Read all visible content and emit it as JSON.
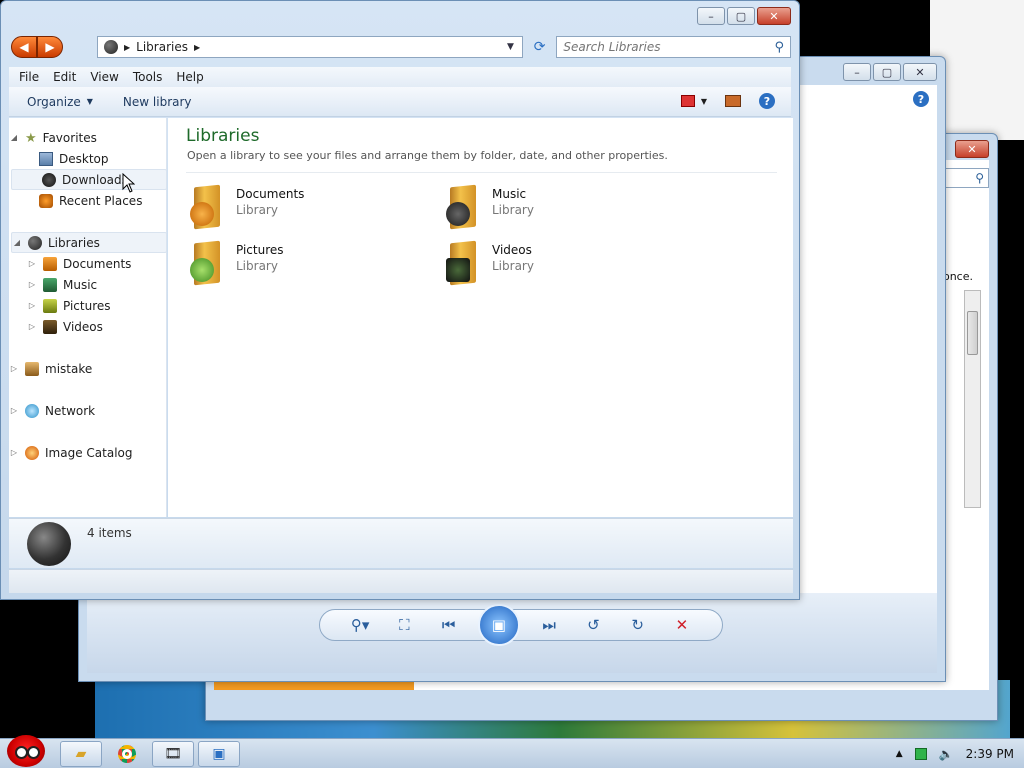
{
  "explorer": {
    "address": {
      "crumb": "Libraries"
    },
    "search_placeholder": "Search Libraries",
    "menu": [
      "File",
      "Edit",
      "View",
      "Tools",
      "Help"
    ],
    "toolbar": {
      "organize": "Organize",
      "new_library": "New library"
    },
    "nav": {
      "favorites": "Favorites",
      "desktop": "Desktop",
      "downloads": "Downloads",
      "recent_places": "Recent Places",
      "libraries": "Libraries",
      "documents": "Documents",
      "music": "Music",
      "pictures": "Pictures",
      "videos": "Videos",
      "mistake": "mistake",
      "network": "Network",
      "image_catalog": "Image Catalog"
    },
    "content": {
      "title": "Libraries",
      "description": "Open a library to see your files and arrange them by folder, date, and other properties.",
      "tiles": [
        {
          "name": "Documents",
          "type": "Library"
        },
        {
          "name": "Music",
          "type": "Library"
        },
        {
          "name": "Pictures",
          "type": "Library"
        },
        {
          "name": "Videos",
          "type": "Library"
        }
      ]
    },
    "details": {
      "count": "4 items"
    }
  },
  "background": {
    "partial_text": "once."
  },
  "taskbar": {
    "clock": "2:39 PM"
  },
  "colors": {
    "accent_green": "#1e6a2a",
    "close_red": "#c6402a",
    "nav_orange": "#e05a10"
  }
}
